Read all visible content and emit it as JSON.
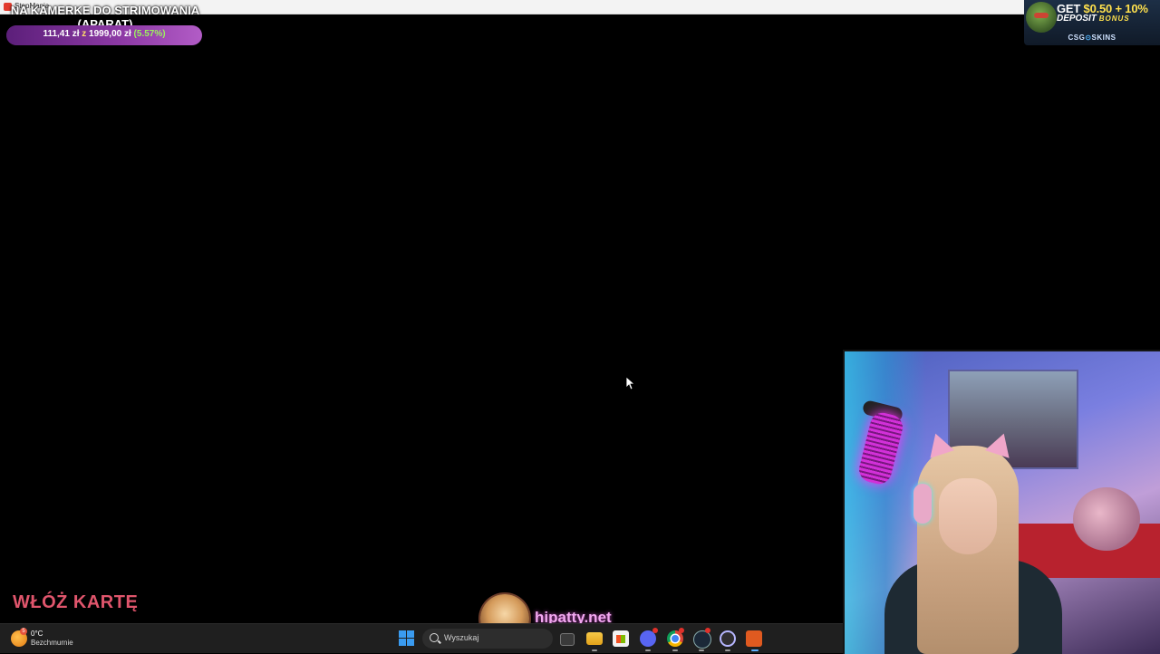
{
  "window": {
    "title": "StepMania"
  },
  "donation_goal": {
    "title_line1": "NA KAMERKE DO STRIMOWANIA",
    "title_line2": "(APARAT)",
    "current": "111,41 zł",
    "separator": "z",
    "target": "1999,00 zł",
    "percent": "(5.57%)",
    "progress_fraction": 0.0557
  },
  "ad": {
    "line1_prefix": "GET",
    "line1_amount": "$0.50 + 10%",
    "line2_main": "DEPOSIT",
    "line2_sub": "BONUS",
    "brand": "CSG",
    "brand_suffix": "SKINS"
  },
  "game": {
    "card_prompt": "WŁÓŻ KARTĘ"
  },
  "social": {
    "handle": "hipatty.net"
  },
  "taskbar": {
    "weather_temp": "0°C",
    "weather_desc": "Bezchmurnie",
    "weather_badge": "5",
    "search_placeholder": "Wyszukaj",
    "icons": [
      "windows-start-icon",
      "search-icon",
      "task-view-icon",
      "file-explorer-icon",
      "microsoft-store-icon",
      "discord-icon",
      "chrome-icon",
      "steam-icon",
      "obs-icon",
      "stepmania-icon"
    ]
  },
  "colors": {
    "card_prompt": "#e0556c",
    "handle": "#f2a8f0",
    "goal_fill": "#8e3aa6",
    "goal_percent": "#9cf25e",
    "ad_highlight": "#ffe14d"
  }
}
